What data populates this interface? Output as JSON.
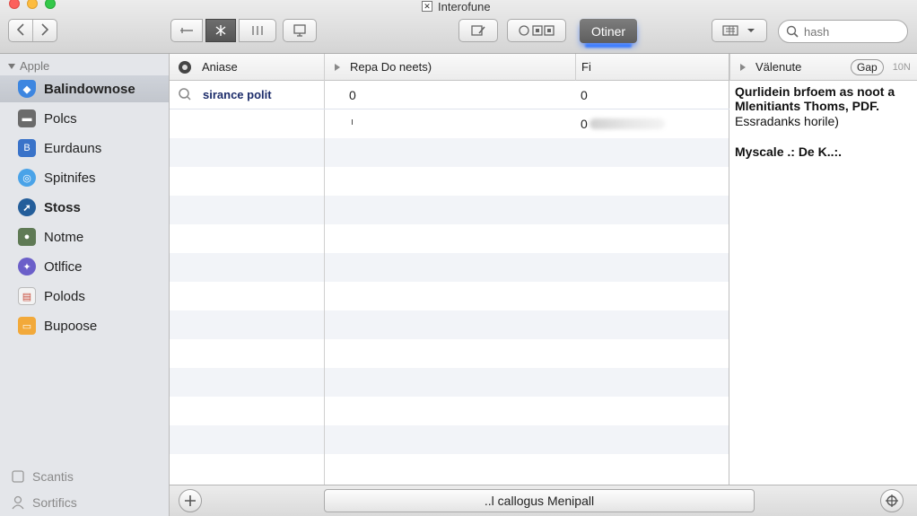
{
  "window": {
    "title": "Interofune"
  },
  "toolbar": {
    "tab_label": "Otiner",
    "search_placeholder": "hash"
  },
  "sidebar": {
    "section_label": "Apple",
    "items": [
      {
        "label": "Balindownose",
        "icon": "shield-icon",
        "color": "#3d86e0"
      },
      {
        "label": "Polcs",
        "icon": "printer-icon",
        "color": "#6b6b6b"
      },
      {
        "label": "Eurdauns",
        "icon": "book-icon",
        "color": "#3a73c9"
      },
      {
        "label": "Spitnifes",
        "icon": "globe-icon",
        "color": "#4aa3e8"
      },
      {
        "label": "Stoss",
        "icon": "compass-icon",
        "color": "#245e9a"
      },
      {
        "label": "Notme",
        "icon": "photo-icon",
        "color": "#5f7a55"
      },
      {
        "label": "Otlfice",
        "icon": "star-icon",
        "color": "#6b5fc9"
      },
      {
        "label": "Polods",
        "icon": "document-icon",
        "color": "#c94b3a"
      },
      {
        "label": "Bupoose",
        "icon": "folder-icon",
        "color": "#f2a93a"
      }
    ],
    "footer": [
      {
        "label": "Scantis",
        "icon": "window-icon"
      },
      {
        "label": "Sortifics",
        "icon": "user-icon"
      }
    ]
  },
  "table": {
    "headers": {
      "col1": "Aniase",
      "col2": "Repa Do neets)",
      "col3": "Fi",
      "col4": "Välenute",
      "col4_button": "Gap",
      "col4_extra": "10N"
    },
    "rows": [
      {
        "name": "sirance polit",
        "col2": "0",
        "col3": "0"
      },
      {
        "name": "",
        "col2": "ı",
        "col3": "0"
      }
    ]
  },
  "detail": {
    "line1": "Qurlidein brfoem as noot a",
    "line2": "Mlenitiants Thoms, PDF.",
    "line3": "Essradanks horile)",
    "line4": "Myscale .: De K..:."
  },
  "bottom": {
    "status_label": "..l callogus Menipall"
  }
}
